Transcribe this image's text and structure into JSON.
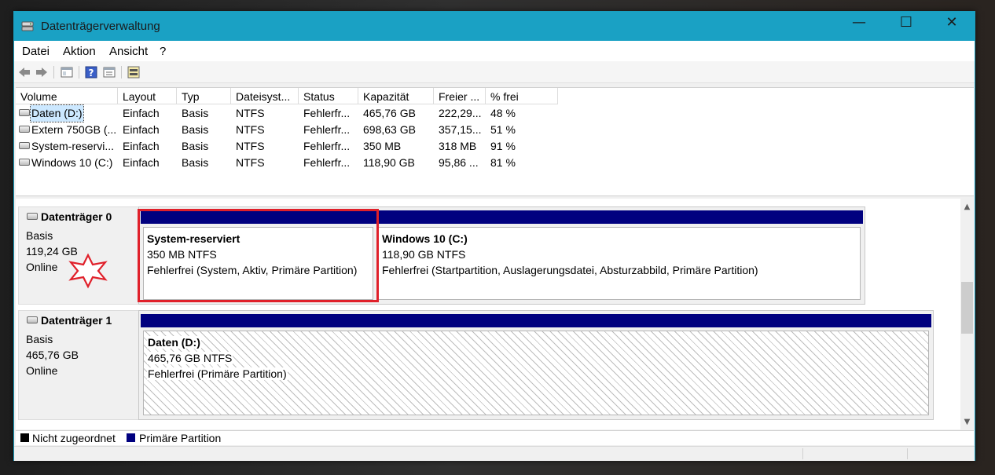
{
  "window": {
    "title": "Datenträgerverwaltung",
    "controls": {
      "minimize": "—",
      "maximize": "☐",
      "close": "✕"
    }
  },
  "menu": [
    {
      "label": "Datei"
    },
    {
      "label": "Aktion"
    },
    {
      "label": "Ansicht"
    },
    {
      "label": "?"
    }
  ],
  "toolbar": [
    "back-icon",
    "forward-icon",
    "show-hide-console-tree-icon",
    "help-icon",
    "properties-icon",
    "rescan-disks-icon"
  ],
  "volume_table": {
    "columns": [
      "Volume",
      "Layout",
      "Typ",
      "Dateisyst...",
      "Status",
      "Kapazität",
      "Freier ...",
      "% frei"
    ],
    "rows": [
      [
        "Daten (D:)",
        "Einfach",
        "Basis",
        "NTFS",
        "Fehlerfr...",
        "465,76 GB",
        "222,29...",
        "48 %"
      ],
      [
        "Extern 750GB (...",
        "Einfach",
        "Basis",
        "NTFS",
        "Fehlerfr...",
        "698,63 GB",
        "357,15...",
        "51 %"
      ],
      [
        "System-reservi...",
        "Einfach",
        "Basis",
        "NTFS",
        "Fehlerfr...",
        "350 MB",
        "318 MB",
        "91 %"
      ],
      [
        "Windows 10 (C:)",
        "Einfach",
        "Basis",
        "NTFS",
        "Fehlerfr...",
        "118,90 GB",
        "95,86 ...",
        "81 %"
      ]
    ],
    "selected_row": 0
  },
  "disks": [
    {
      "name": "Datenträger 0",
      "type": "Basis",
      "size": "119,24 GB",
      "state": "Online",
      "partitions": [
        {
          "title": "System-reserviert",
          "size": "350 MB NTFS",
          "status": "Fehlerfrei (System, Aktiv, Primäre Partition)"
        },
        {
          "title": "Windows 10  (C:)",
          "size": "118,90 GB NTFS",
          "status": "Fehlerfrei (Startpartition, Auslagerungsdatei, Absturzabbild, Primäre Partition)"
        }
      ]
    },
    {
      "name": "Datenträger 1",
      "type": "Basis",
      "size": "465,76 GB",
      "state": "Online",
      "partitions": [
        {
          "title": "Daten  (D:)",
          "size": "465,76 GB NTFS",
          "status": "Fehlerfrei (Primäre Partition)"
        }
      ]
    }
  ],
  "legend": [
    {
      "label": "Nicht zugeordnet",
      "color": "#000000"
    },
    {
      "label": "Primäre Partition",
      "color": "#00007f"
    }
  ],
  "colors": {
    "titlebar": "#1aa1c4",
    "primary_partition": "#00007f",
    "highlight_box": "#e0202a"
  }
}
